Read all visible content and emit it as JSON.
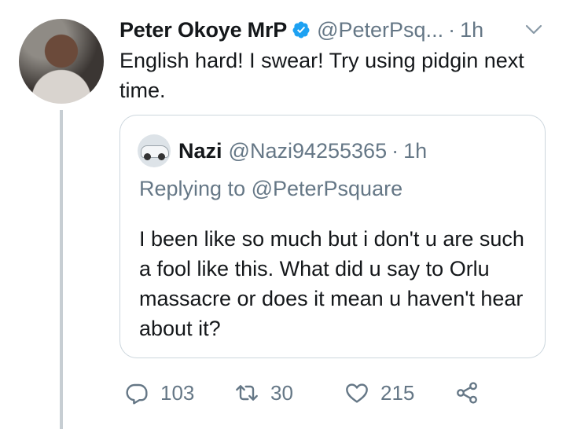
{
  "tweet": {
    "author_name": "Peter Okoye MrP",
    "handle": "@PeterPsq...",
    "separator": "·",
    "time": "1h",
    "text": "English hard! I swear! Try using pidgin next time."
  },
  "quoted_tweet": {
    "author_name": "Nazi",
    "handle": "@Nazi94255365",
    "separator": "·",
    "time": "1h",
    "replying_to": "Replying to @PeterPsquare",
    "text": "I been like so much but i don't u are such a fool like this. What did u say to Orlu massacre or does it mean u haven't hear about it?"
  },
  "actions": {
    "reply_count": "103",
    "retweet_count": "30",
    "like_count": "215"
  },
  "colors": {
    "verified": "#1da1f2",
    "secondary_text": "#657786",
    "border": "#ccd6dd",
    "thread_line": "#c7ced3"
  },
  "icons": [
    "chevron-down-icon",
    "verified-badge-icon",
    "reply-icon",
    "retweet-icon",
    "like-icon",
    "share-icon"
  ]
}
